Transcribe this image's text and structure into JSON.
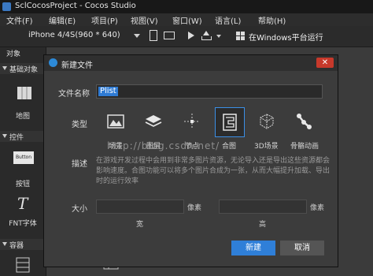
{
  "window": {
    "title": "SclCocosProject - Cocos Studio"
  },
  "menu": [
    "文件(F)",
    "编辑(E)",
    "项目(P)",
    "视图(V)",
    "窗口(W)",
    "语言(L)",
    "帮助(H)"
  ],
  "toolbar": {
    "device": "iPhone 4/4S(960 * 640)",
    "run_label": "在Windows平台运行"
  },
  "sidebar": {
    "panel_title": "对象",
    "sections": [
      "基础对象",
      "控件",
      "容器"
    ],
    "items": [
      "地图",
      "按钮",
      "FNT字体"
    ],
    "button_text": "Button"
  },
  "dialog": {
    "title": "新建文件",
    "close": "✕",
    "name_label": "文件名称",
    "name_value": "Plist",
    "type_label": "类型",
    "types": [
      "场景",
      "图层",
      "节点",
      "合图",
      "3D场景",
      "骨骼动画"
    ],
    "watermark": "http://blog.csdn.net/",
    "desc_label": "描述",
    "desc_text": "在游戏开发过程中会用到非常多图片资源，无论导入还是导出这些资源都会影响速度。合图功能可以将多个图片合成为一张，从而大幅提升加载、导出时的运行效率",
    "size_label": "大小",
    "unit": "像素",
    "width_label": "宽",
    "height_label": "高",
    "ok": "新建",
    "cancel": "取消"
  },
  "colors": {
    "accent": "#2f7fd8",
    "close": "#c7392b"
  }
}
